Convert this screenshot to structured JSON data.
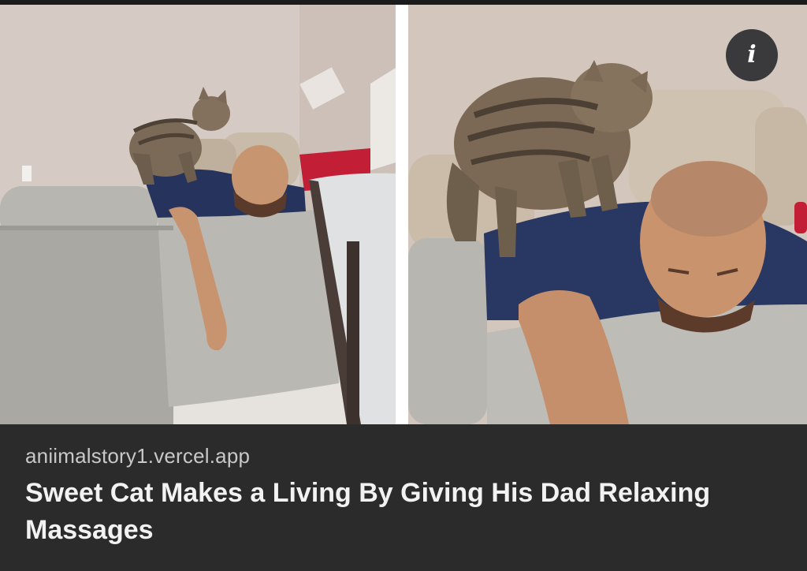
{
  "link_preview": {
    "images": [
      {
        "name": "cat-massage-photo-left"
      },
      {
        "name": "cat-massage-photo-right"
      }
    ],
    "info_icon": "info-icon",
    "info_glyph": "i",
    "domain": "aniimalstory1.vercel.app",
    "headline": "Sweet Cat Makes a Living By Giving His Dad Relaxing Massages"
  },
  "colors": {
    "background": "#2b2b2c",
    "domain_text": "#c8c8c8",
    "headline_text": "#f2f2f2",
    "info_button": "#3a3a3c"
  }
}
